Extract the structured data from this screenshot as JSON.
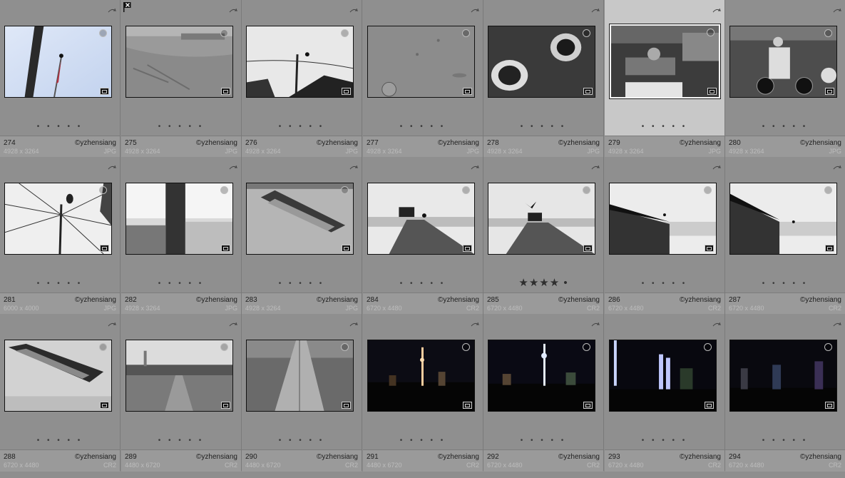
{
  "grid": {
    "rows": [
      [
        {
          "num": "274",
          "copyright": "©yzhensiang",
          "dims": "4928 x 3264",
          "ext": "JPG",
          "rating": "• • • • •",
          "stars": false,
          "selected": false,
          "rejected": false,
          "scene": "flag"
        },
        {
          "num": "275",
          "copyright": "©yzhensiang",
          "dims": "4928 x 3264",
          "ext": "JPG",
          "rating": "• • • • •",
          "stars": false,
          "selected": false,
          "rejected": true,
          "scene": "mudflat"
        },
        {
          "num": "276",
          "copyright": "©yzhensiang",
          "dims": "4928 x 3264",
          "ext": "JPG",
          "rating": "• • • • •",
          "stars": false,
          "selected": false,
          "rejected": false,
          "scene": "pole-bird"
        },
        {
          "num": "277",
          "copyright": "©yzhensiang",
          "dims": "4928 x 3264",
          "ext": "JPG",
          "rating": "• • • • •",
          "stars": false,
          "selected": false,
          "rejected": false,
          "scene": "ground"
        },
        {
          "num": "278",
          "copyright": "©yzhensiang",
          "dims": "4928 x 3264",
          "ext": "JPG",
          "rating": "• • • • •",
          "stars": false,
          "selected": false,
          "rejected": false,
          "scene": "pipes"
        },
        {
          "num": "279",
          "copyright": "©yzhensiang",
          "dims": "4928 x 3264",
          "ext": "JPG",
          "rating": "• • • • •",
          "stars": false,
          "selected": true,
          "rejected": false,
          "scene": "street"
        },
        {
          "num": "280",
          "copyright": "©yzhensiang",
          "dims": "4928 x 3264",
          "ext": "JPG",
          "rating": "• • • • •",
          "stars": false,
          "selected": false,
          "rejected": false,
          "scene": "motorbike"
        }
      ],
      [
        {
          "num": "281",
          "copyright": "©yzhensiang",
          "dims": "6000 x 4000",
          "ext": "JPG",
          "rating": "• • • • •",
          "stars": false,
          "selected": false,
          "rejected": false,
          "scene": "wires"
        },
        {
          "num": "282",
          "copyright": "©yzhensiang",
          "dims": "4928 x 3264",
          "ext": "JPG",
          "rating": "• • • • •",
          "stars": false,
          "selected": false,
          "rejected": false,
          "scene": "chain"
        },
        {
          "num": "283",
          "copyright": "©yzhensiang",
          "dims": "4928 x 3264",
          "ext": "JPG",
          "rating": "• • • • •",
          "stars": false,
          "selected": false,
          "rejected": false,
          "scene": "boat"
        },
        {
          "num": "284",
          "copyright": "©yzhensiang",
          "dims": "6720 x 4480",
          "ext": "CR2",
          "rating": "• • • • •",
          "stars": false,
          "selected": false,
          "rejected": false,
          "scene": "jetty-hut"
        },
        {
          "num": "285",
          "copyright": "©yzhensiang",
          "dims": "6720 x 4480",
          "ext": "CR2",
          "rating": "★★★★ •",
          "stars": true,
          "selected": false,
          "rejected": false,
          "scene": "jetty-bird"
        },
        {
          "num": "286",
          "copyright": "©yzhensiang",
          "dims": "6720 x 4480",
          "ext": "CR2",
          "rating": "• • • • •",
          "stars": false,
          "selected": false,
          "rejected": false,
          "scene": "shed"
        },
        {
          "num": "287",
          "copyright": "©yzhensiang",
          "dims": "6720 x 4480",
          "ext": "CR2",
          "rating": "• • • • •",
          "stars": false,
          "selected": false,
          "rejected": false,
          "scene": "shed2"
        }
      ],
      [
        {
          "num": "288",
          "copyright": "©yzhensiang",
          "dims": "6720 x 4480",
          "ext": "CR2",
          "rating": "• • • • •",
          "stars": false,
          "selected": false,
          "rejected": false,
          "scene": "boat2"
        },
        {
          "num": "289",
          "copyright": "©yzhensiang",
          "dims": "4480 x 6720",
          "ext": "CR2",
          "rating": "• • • • •",
          "stars": false,
          "selected": false,
          "rejected": false,
          "scene": "village"
        },
        {
          "num": "290",
          "copyright": "©yzhensiang",
          "dims": "4480 x 6720",
          "ext": "CR2",
          "rating": "• • • • •",
          "stars": false,
          "selected": false,
          "rejected": false,
          "scene": "boardwalk"
        },
        {
          "num": "291",
          "copyright": "©yzhensiang",
          "dims": "4480 x 6720",
          "ext": "CR2",
          "rating": "• • • • •",
          "stars": false,
          "selected": false,
          "rejected": false,
          "scene": "city1"
        },
        {
          "num": "292",
          "copyright": "©yzhensiang",
          "dims": "6720 x 4480",
          "ext": "CR2",
          "rating": "• • • • •",
          "stars": false,
          "selected": false,
          "rejected": false,
          "scene": "city2"
        },
        {
          "num": "293",
          "copyright": "©yzhensiang",
          "dims": "6720 x 4480",
          "ext": "CR2",
          "rating": "• • • • •",
          "stars": false,
          "selected": false,
          "rejected": false,
          "scene": "city3"
        },
        {
          "num": "294",
          "copyright": "©yzhensiang",
          "dims": "6720 x 4480",
          "ext": "CR2",
          "rating": "• • • • •",
          "stars": false,
          "selected": false,
          "rejected": false,
          "scene": "city4"
        }
      ]
    ]
  }
}
